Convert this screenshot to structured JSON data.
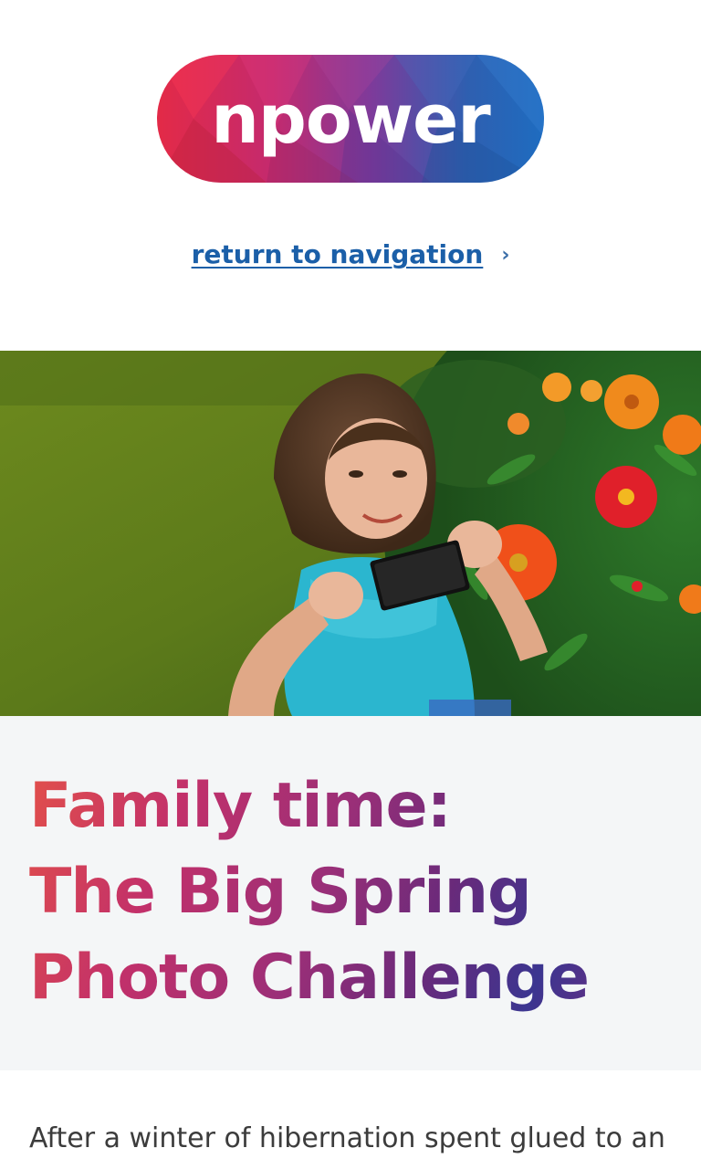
{
  "header": {
    "logo_text": "npower",
    "return_link": "return to navigation",
    "return_chevron": "›"
  },
  "hero": {
    "image_subject": "girl photographing flowers with a phone"
  },
  "article": {
    "title_lines": [
      "Family time:",
      "The Big Spring",
      "Photo Challenge"
    ],
    "intro": "After a winter of hibernation spent glued to an"
  },
  "colors": {
    "link": "#1b5fa8",
    "title_start": "#e2504a",
    "title_mid": "#9a2f78",
    "title_end": "#3b3590",
    "title_bg": "#f4f6f7",
    "body_text": "#3c3c3c"
  }
}
